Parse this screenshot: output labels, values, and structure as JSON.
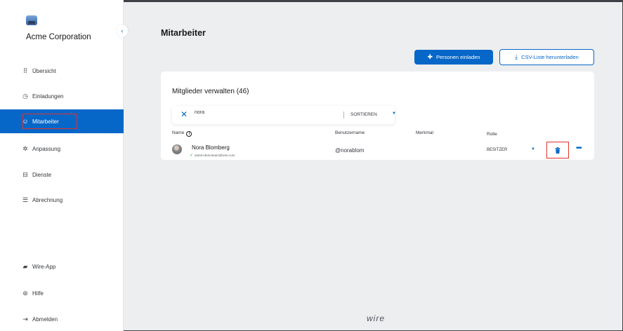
{
  "sidebar": {
    "org_name": "Acme Corporation",
    "collapse_icon": "chevron-left-icon",
    "items": [
      {
        "label": "Übersicht",
        "icon": "grid-icon",
        "glyph": "⠿"
      },
      {
        "label": "Einladungen",
        "icon": "clock-icon",
        "glyph": "◷"
      },
      {
        "label": "Mitarbeiter",
        "icon": "user-circle-icon",
        "glyph": "☺",
        "active": true
      },
      {
        "label": "Anpassung",
        "icon": "settings-icon",
        "glyph": "✲"
      },
      {
        "label": "Dienste",
        "icon": "services-icon",
        "glyph": "⊟"
      },
      {
        "label": "Abrechnung",
        "icon": "list-icon",
        "glyph": "☰"
      },
      {
        "label": "Wire-App",
        "icon": "chat-icon",
        "glyph": "▰"
      },
      {
        "label": "Hilfe",
        "icon": "help-icon",
        "glyph": "⊛"
      },
      {
        "label": "Abmelden",
        "icon": "logout-icon",
        "glyph": "⇥"
      }
    ]
  },
  "main": {
    "title": "Mitarbeiter",
    "invite_button": "Personen einladen",
    "csv_button": "CSV-Liste herunterladen"
  },
  "card": {
    "title": "Mitglieder verwalten (46)",
    "search_value": "nora",
    "sort_label": "SORTIEREN",
    "columns": {
      "name": "Name",
      "username": "Benutzername",
      "feature": "Merkmal",
      "role": "Rolle"
    },
    "rows": [
      {
        "name": "Nora Blomberg",
        "email": "astrid+demoteam@wire.com",
        "username": "@norablom",
        "feature": "",
        "role": "BESITZER"
      }
    ]
  },
  "footer": {
    "brand": "wire"
  },
  "colors": {
    "accent": "#0667c8",
    "highlight": "#e0322b"
  }
}
